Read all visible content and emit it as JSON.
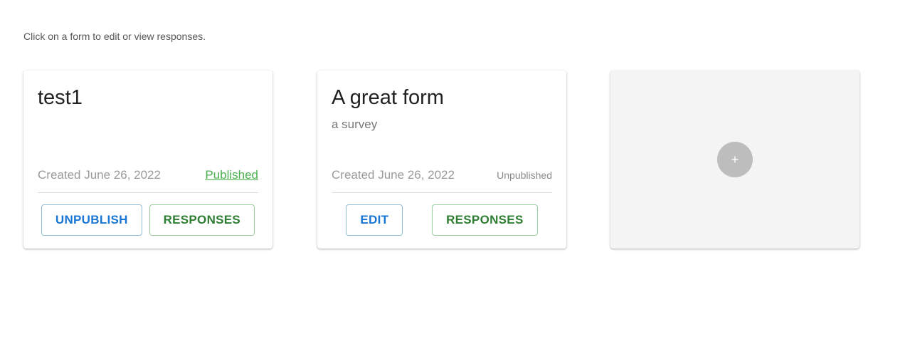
{
  "intro_text": "Click on a form to edit or view responses.",
  "forms": [
    {
      "title": "test1",
      "subtitle": "",
      "created": "Created June 26, 2022",
      "status": "Published",
      "primary_action": "UNPUBLISH",
      "secondary_action": "RESPONSES"
    },
    {
      "title": "A great form",
      "subtitle": "a survey",
      "created": "Created June 26, 2022",
      "status": "Unpublished",
      "primary_action": "EDIT",
      "secondary_action": "RESPONSES"
    }
  ],
  "add_card": {
    "icon": "plus-icon",
    "glyph": "+"
  },
  "colors": {
    "primary_blue": "#1976d2",
    "green": "#2e7d32",
    "published_green": "#4caf50",
    "add_circle": "#bdbdbd",
    "add_card_bg": "#f4f4f4"
  }
}
